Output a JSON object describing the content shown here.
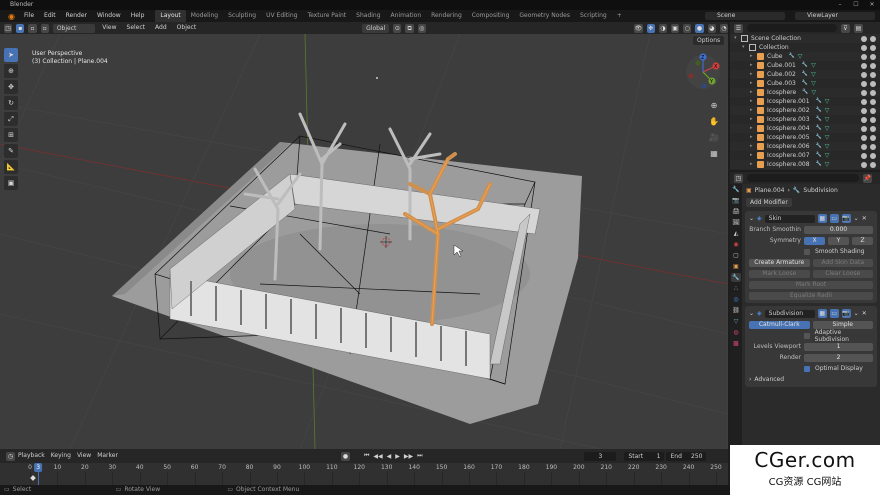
{
  "title_bar": {
    "app_name": "Blender"
  },
  "top_menu": [
    "File",
    "Edit",
    "Render",
    "Window",
    "Help"
  ],
  "workspaces": [
    {
      "label": "Layout",
      "active": true
    },
    {
      "label": "Modeling",
      "active": false
    },
    {
      "label": "Sculpting",
      "active": false
    },
    {
      "label": "UV Editing",
      "active": false
    },
    {
      "label": "Texture Paint",
      "active": false
    },
    {
      "label": "Shading",
      "active": false
    },
    {
      "label": "Animation",
      "active": false
    },
    {
      "label": "Rendering",
      "active": false
    },
    {
      "label": "Compositing",
      "active": false
    },
    {
      "label": "Geometry Nodes",
      "active": false
    },
    {
      "label": "Scripting",
      "active": false
    }
  ],
  "add_workspace": "+",
  "scene": {
    "name": "Scene"
  },
  "view_layer": {
    "name": "ViewLayer"
  },
  "viewport_header": {
    "mode": "Object Mode",
    "menus": [
      "View",
      "Select",
      "Add",
      "Object"
    ],
    "transform_orientation": "Global",
    "options": "Options"
  },
  "viewport_info": {
    "line1": "User Perspective",
    "line2": "(3) Collection | Plane.004"
  },
  "gizmo": {
    "x": "X",
    "y": "Y",
    "z": "Z"
  },
  "outliner": {
    "rows": [
      {
        "label": "Scene Collection",
        "level": 0,
        "type": "scene"
      },
      {
        "label": "Collection",
        "level": 1,
        "type": "collection"
      },
      {
        "label": "Cube",
        "level": 2,
        "type": "mesh"
      },
      {
        "label": "Cube.001",
        "level": 2,
        "type": "mesh"
      },
      {
        "label": "Cube.002",
        "level": 2,
        "type": "mesh"
      },
      {
        "label": "Cube.003",
        "level": 2,
        "type": "mesh"
      },
      {
        "label": "Icosphere",
        "level": 2,
        "type": "mesh"
      },
      {
        "label": "Icosphere.001",
        "level": 2,
        "type": "mesh"
      },
      {
        "label": "Icosphere.002",
        "level": 2,
        "type": "mesh"
      },
      {
        "label": "Icosphere.003",
        "level": 2,
        "type": "mesh"
      },
      {
        "label": "Icosphere.004",
        "level": 2,
        "type": "mesh"
      },
      {
        "label": "Icosphere.005",
        "level": 2,
        "type": "mesh"
      },
      {
        "label": "Icosphere.006",
        "level": 2,
        "type": "mesh"
      },
      {
        "label": "Icosphere.007",
        "level": 2,
        "type": "mesh"
      },
      {
        "label": "Icosphere.008",
        "level": 2,
        "type": "mesh"
      }
    ]
  },
  "properties": {
    "breadcrumb_object": "Plane.004",
    "breadcrumb_modifier": "Subdivision",
    "add_modifier": "Add Modifier",
    "skin": {
      "name": "Skin",
      "branch_smoothing_label": "Branch Smoothin",
      "branch_smoothing_value": "0.000",
      "symmetry_label": "Symmetry",
      "sym_x": "X",
      "sym_y": "Y",
      "sym_z": "Z",
      "smooth_shading": "Smooth Shading",
      "create_armature": "Create Armature",
      "add_skin_data": "Add Skin Data",
      "mark_loose": "Mark Loose",
      "clear_loose": "Clear Loose",
      "mark_root": "Mark Root",
      "equalize_radii": "Equalize Radii"
    },
    "subdivision": {
      "name": "Subdivision",
      "catmull_clark": "Catmull-Clark",
      "simple": "Simple",
      "adaptive": "Adaptive Subdivision",
      "levels_viewport_label": "Levels Viewport",
      "levels_viewport_value": "1",
      "render_label": "Render",
      "render_value": "2",
      "optimal_display": "Optimal Display",
      "advanced": "Advanced"
    }
  },
  "timeline": {
    "menus": [
      "Playback",
      "Keying",
      "View",
      "Marker"
    ],
    "current_frame": "3",
    "start_label": "Start",
    "start": "1",
    "end_label": "End",
    "end": "250",
    "ticks": [
      "0",
      "10",
      "20",
      "30",
      "40",
      "50",
      "60",
      "70",
      "80",
      "90",
      "100",
      "110",
      "120",
      "130",
      "140",
      "150",
      "160",
      "170",
      "180",
      "190",
      "200",
      "210",
      "220",
      "230",
      "240",
      "250"
    ],
    "playhead": "3"
  },
  "status_bar": {
    "select": "Select",
    "rotate": "Rotate View",
    "context": "Object Context Menu"
  },
  "watermark": {
    "line1": "CGer.com",
    "line2": "CG资源 CG网站"
  }
}
